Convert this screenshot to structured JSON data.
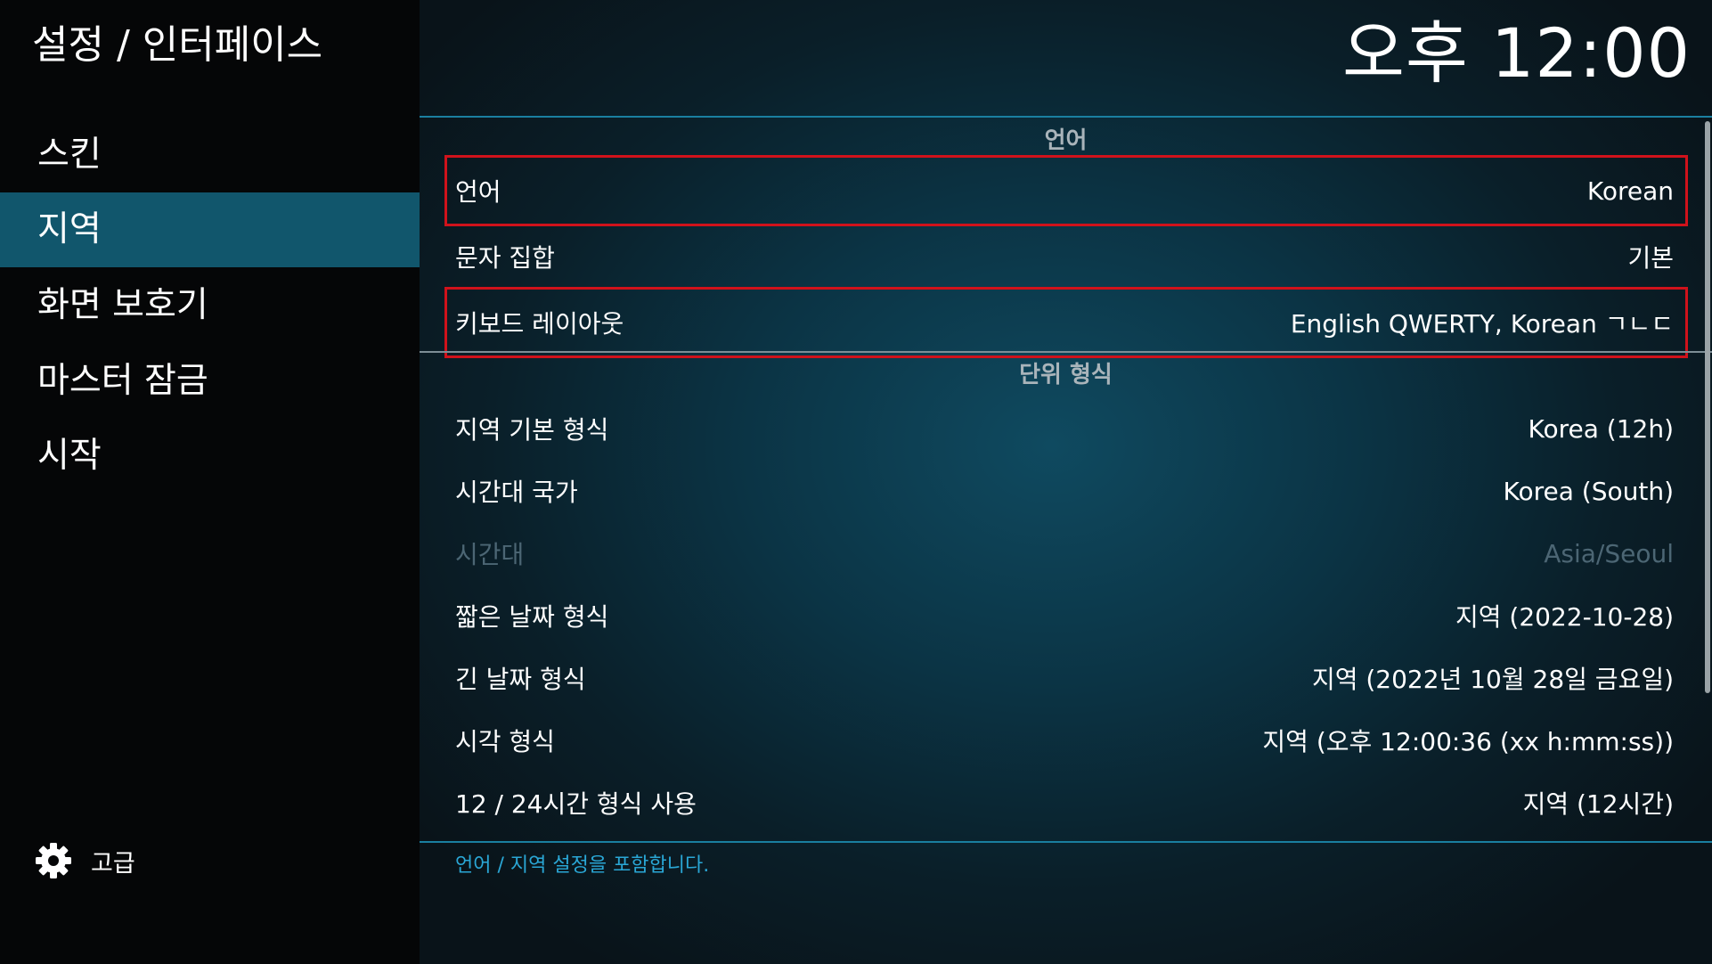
{
  "header": {
    "title": "설정 / 인터페이스",
    "clock": "오후 12:00"
  },
  "sidebar": {
    "items": [
      {
        "label": "스킨"
      },
      {
        "label": "지역"
      },
      {
        "label": "화면 보호기"
      },
      {
        "label": "마스터 잠금"
      },
      {
        "label": "시작"
      }
    ],
    "active_index": 1,
    "advanced": {
      "label": "고급",
      "icon": "gear-icon"
    }
  },
  "sections": [
    {
      "header": "언어",
      "rows": [
        {
          "label": "언어",
          "value": "Korean",
          "highlighted": true
        },
        {
          "label": "문자 집합",
          "value": "기본"
        },
        {
          "label": "키보드 레이아웃",
          "value": "English QWERTY, Korean ㄱㄴㄷ",
          "highlighted": true
        }
      ]
    },
    {
      "header": "단위 형식",
      "rows": [
        {
          "label": "지역 기본 형식",
          "value": "Korea (12h)"
        },
        {
          "label": "시간대 국가",
          "value": "Korea (South)"
        },
        {
          "label": "시간대",
          "value": "Asia/Seoul",
          "disabled": true
        },
        {
          "label": "짧은 날짜 형식",
          "value": "지역 (2022-10-28)"
        },
        {
          "label": "긴 날짜 형식",
          "value": "지역 (2022년 10월 28일 금요일)"
        },
        {
          "label": "시각 형식",
          "value": "지역 (오후 12:00:36 (xx h:mm:ss))"
        },
        {
          "label": "12 / 24시간 형식 사용",
          "value": "지역 (12시간)"
        }
      ]
    }
  ],
  "description": "언어 / 지역 설정을 포함합니다.",
  "colors": {
    "accent": "#11566c",
    "highlight_outline": "#d0121b",
    "description_text": "#2aa7d6",
    "disabled_text": "#4c6674"
  }
}
